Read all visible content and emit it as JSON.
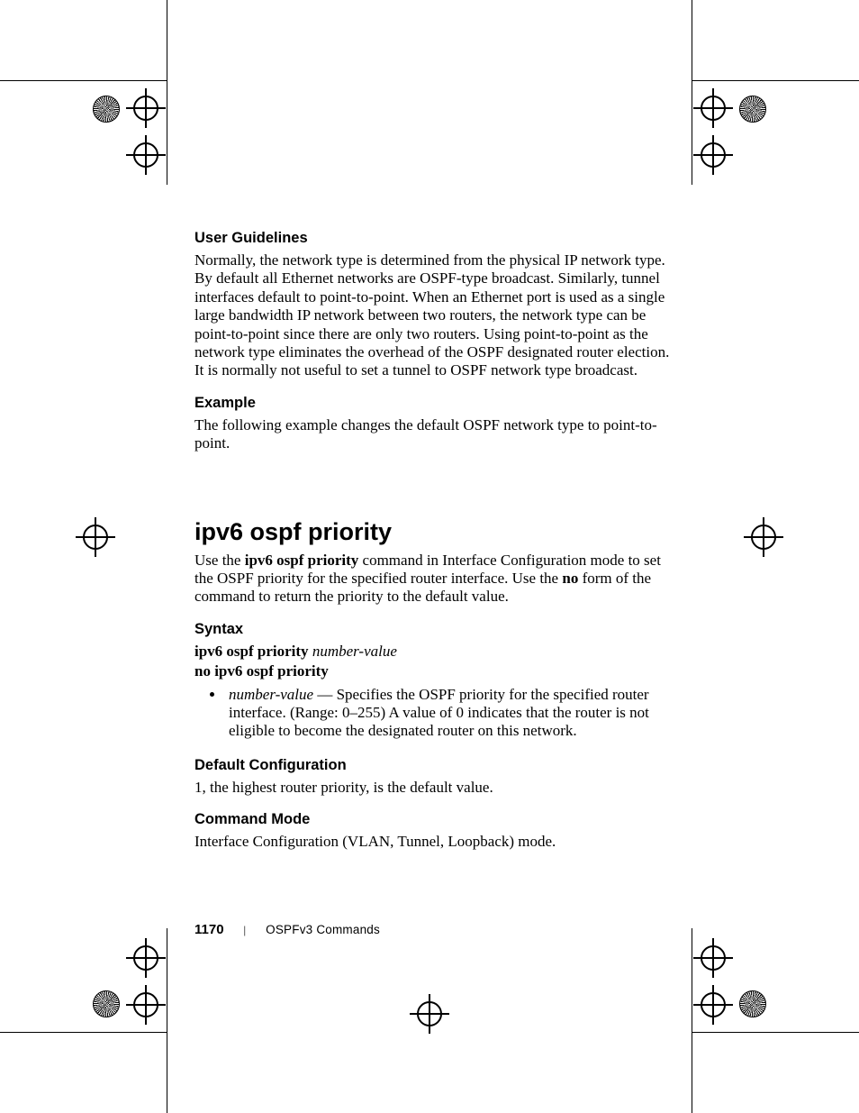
{
  "sections": {
    "user_guidelines": {
      "heading": "User Guidelines",
      "body": "Normally, the network type is determined from the physical IP network type. By default all Ethernet networks are OSPF-type broadcast. Similarly, tunnel interfaces default to point-to-point. When an Ethernet port is used as a single large bandwidth IP network between two routers, the network type can be point-to-point since there are only two routers. Using point-to-point as the network type eliminates the overhead of the OSPF designated router election. It is normally not useful to set a tunnel to OSPF network type broadcast."
    },
    "example": {
      "heading": "Example",
      "body": "The following example changes the default OSPF network type to point-to-point."
    },
    "command": {
      "title": "ipv6 ospf priority",
      "intro_pre": "Use the ",
      "intro_cmd": "ipv6 ospf priority",
      "intro_mid": " command in Interface Configuration mode to set the OSPF priority for the specified router interface. Use the ",
      "intro_no": "no",
      "intro_post": " form of the command to return the priority to the default value."
    },
    "syntax": {
      "heading": "Syntax",
      "line1_bold": "ipv6 ospf priority ",
      "line1_ital": "number-value",
      "line2_bold": "no ipv6 ospf priority",
      "bullet_param": "number-value",
      "bullet_text": " — Specifies the OSPF priority for the specified router interface. (Range: 0–255) A value of 0 indicates that the router is not eligible to become the designated router on this network."
    },
    "default_config": {
      "heading": "Default Configuration",
      "body": "1, the highest router priority, is the default value."
    },
    "command_mode": {
      "heading": "Command Mode",
      "body": "Interface Configuration (VLAN, Tunnel, Loopback) mode."
    }
  },
  "footer": {
    "page_number": "1170",
    "separator": "|",
    "chapter": "OSPFv3 Commands"
  }
}
